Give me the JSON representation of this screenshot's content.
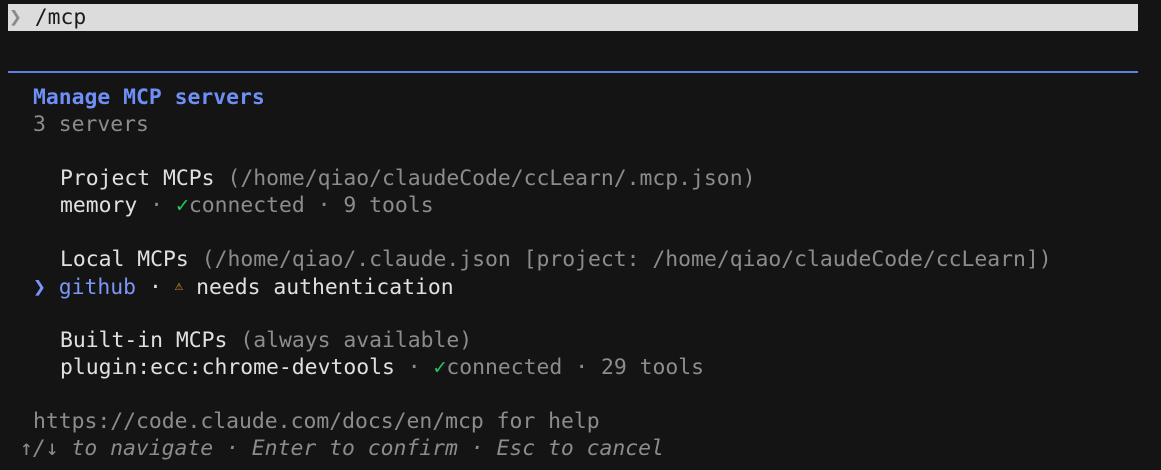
{
  "prompt": {
    "chevron": "❯",
    "command": "/mcp"
  },
  "header": {
    "title": "Manage MCP servers",
    "subtitle": "3 servers"
  },
  "groups": [
    {
      "label": "Project MCPs",
      "path": "(/home/qiao/claudeCode/ccLearn/.mcp.json)",
      "servers": [
        {
          "name": "memory",
          "sep": "·",
          "status_icon": "✓",
          "status": "connected",
          "sep2": "·",
          "tools": "9 tools"
        }
      ]
    },
    {
      "label": "Local MCPs",
      "path": "(/home/qiao/.claude.json [project: /home/qiao/claudeCode/ccLearn])",
      "servers": [
        {
          "cursor": "❯",
          "name": "github",
          "sep": "·",
          "status_icon": "⚠",
          "status": "needs authentication"
        }
      ]
    },
    {
      "label": "Built-in MCPs",
      "path": "(always available)",
      "servers": [
        {
          "name": "plugin:ecc:chrome-devtools",
          "sep": "·",
          "status_icon": "✓",
          "status": "connected",
          "sep2": "·",
          "tools": "29 tools"
        }
      ]
    }
  ],
  "footer": {
    "help": "https://code.claude.com/docs/en/mcp for help",
    "hints": "↑/↓ to navigate · Enter to confirm · Esc to cancel"
  },
  "colors": {
    "accent": "#6e8ff5",
    "connected": "#22c55e",
    "warning": "#e8a530",
    "background": "#141414"
  }
}
